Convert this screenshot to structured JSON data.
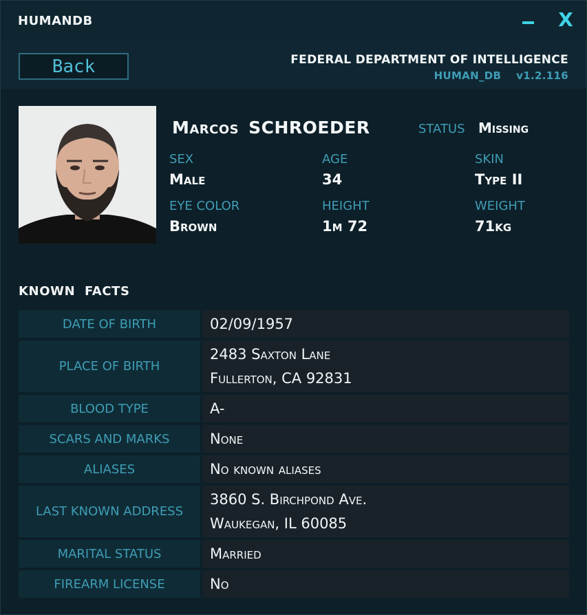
{
  "window": {
    "title": "HUMANDB",
    "minimize_icon": "minimize-icon",
    "close_icon": "close-icon",
    "close_glyph": "X"
  },
  "header": {
    "back_label": "Back",
    "agency": "FEDERAL DEPARTMENT OF INTELLIGENCE",
    "db_name": "HUMAN_DB",
    "version": "v1.2.116"
  },
  "profile": {
    "first_name": "Marcos",
    "last_name": "SCHROEDER",
    "status_label": "STATUS",
    "status_value": "Missing",
    "attributes": [
      {
        "label": "SEX",
        "value": "Male"
      },
      {
        "label": "AGE",
        "value": "34"
      },
      {
        "label": "SKIN",
        "value": "Type II"
      },
      {
        "label": "EYE COLOR",
        "value": "Brown"
      },
      {
        "label": "HEIGHT",
        "value": "1m 72"
      },
      {
        "label": "WEIGHT",
        "value": "71kg"
      }
    ]
  },
  "facts": {
    "title": "KNOWN  FACTS",
    "rows": [
      {
        "key": "DATE OF BIRTH",
        "lines": [
          "02/09/1957"
        ]
      },
      {
        "key": "PLACE OF BIRTH",
        "lines": [
          "2483 Saxton Lane",
          "Fullerton, CA 92831"
        ]
      },
      {
        "key": "BLOOD TYPE",
        "lines": [
          "A-"
        ]
      },
      {
        "key": "SCARS AND MARKS",
        "lines": [
          "None"
        ]
      },
      {
        "key": "ALIASES",
        "lines": [
          "No known aliases"
        ]
      },
      {
        "key": "LAST KNOWN ADDRESS",
        "lines": [
          "3860 S. Birchpond Ave.",
          "Waukegan, IL 60085"
        ]
      },
      {
        "key": "MARITAL STATUS",
        "lines": [
          "Married"
        ]
      },
      {
        "key": "FIREARM LICENSE",
        "lines": [
          "No"
        ]
      }
    ]
  },
  "colors": {
    "accent": "#3fd3e6",
    "label": "#3f9db6",
    "background": "#0d1f28"
  }
}
